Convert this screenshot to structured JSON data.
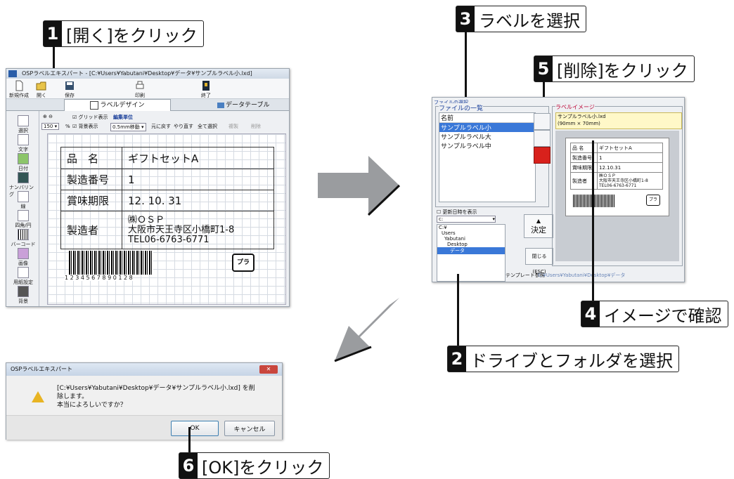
{
  "callouts": [
    {
      "num": "1",
      "text": "[開く]をクリック"
    },
    {
      "num": "2",
      "text": "ドライブとフォルダを選択"
    },
    {
      "num": "3",
      "text": "ラベルを選択"
    },
    {
      "num": "4",
      "text": "イメージで確認"
    },
    {
      "num": "5",
      "text": "[削除]をクリック"
    },
    {
      "num": "6",
      "text": "[OK]をクリック"
    }
  ],
  "editor": {
    "title": "OSPラベルエキスパート - [C:¥Users¥Yabutani¥Desktop¥データ¥サンプルラベル小.lxd]",
    "toolbar": [
      "新規作成",
      "開く",
      "保存",
      "印刷",
      "終了"
    ],
    "tabs": [
      "ラベルデザイン",
      "データテーブル"
    ],
    "grid_toggle": "グリッド表示",
    "bg_toggle": "背景表示",
    "edit_unit_label": "編集単位",
    "edit_unit_value": "0.5mm移動",
    "zoom": "150",
    "zoom_unit": "%",
    "actions": [
      "元に戻す",
      "やり直す",
      "全て選択",
      "複製",
      "削除"
    ],
    "tools": [
      "選択",
      "文字",
      "日付",
      "ナンバリング",
      "線",
      "四角/円",
      "バーコード",
      "画像",
      "用紙設定",
      "背景"
    ],
    "label": {
      "rows": [
        {
          "k": "品　名",
          "v": "ギフトセットA"
        },
        {
          "k": "製造番号",
          "v": "1"
        },
        {
          "k": "賞味期限",
          "v": "12. 10. 31"
        }
      ],
      "maker_key": "製造者",
      "maker_lines": [
        "㈱ＯＳＰ",
        "大阪市天王寺区小橋町1-8",
        "TEL06-6763-6771"
      ],
      "barcode_text": "1 2 3 4 5 6 7   8 9 0 1 2 8",
      "recycle_mark": "プラ"
    }
  },
  "file_dialog": {
    "title": "ファイルの選択",
    "group_label": "ファイルの一覧",
    "column_name": "名前",
    "files": [
      "サンプルラベル小",
      "サンプルラベル大",
      "サンプルラベル中"
    ],
    "sort_check": "更新日時を表示",
    "drive": "c:",
    "folders": [
      "C:¥",
      "Users",
      "Yabutani",
      "Desktop",
      "データ"
    ],
    "preview_label": "ラベルイメージ",
    "preview_name": "サンプルラベル小.lxd",
    "preview_size": "(90mm × 70mm)",
    "preview_rows": [
      {
        "k": "品 名",
        "v": "ギフトセットA"
      },
      {
        "k": "製造番号",
        "v": "1"
      },
      {
        "k": "賞味期限",
        "v": "12.10.31"
      }
    ],
    "preview_maker_key": "製造者",
    "preview_maker_lines": [
      "㈱ＯＳＰ",
      "大阪市天王寺区小橋町1-8",
      "TEL06-6763-6771"
    ],
    "ok_button": "決定",
    "close_button": "閉じる(ESC)",
    "template_button": "テンプレート参照",
    "status_path": "C:¥Users¥Yabutani¥Desktop¥データ"
  },
  "confirm": {
    "title": "OSPラベルエキスパート",
    "message_line1": "[C:¥Users¥Yabutani¥Desktop¥データ¥サンプルラベル小.lxd] を削",
    "message_line2": "除します。",
    "message_line3": "本当によろしいですか？",
    "ok": "OK",
    "cancel": "キャンセル"
  },
  "colors": {
    "arrow": "#9a9c9f",
    "selection": "#3a78d8",
    "delete_button": "#d8211c",
    "preview_name_bg": "#fff8c8"
  }
}
